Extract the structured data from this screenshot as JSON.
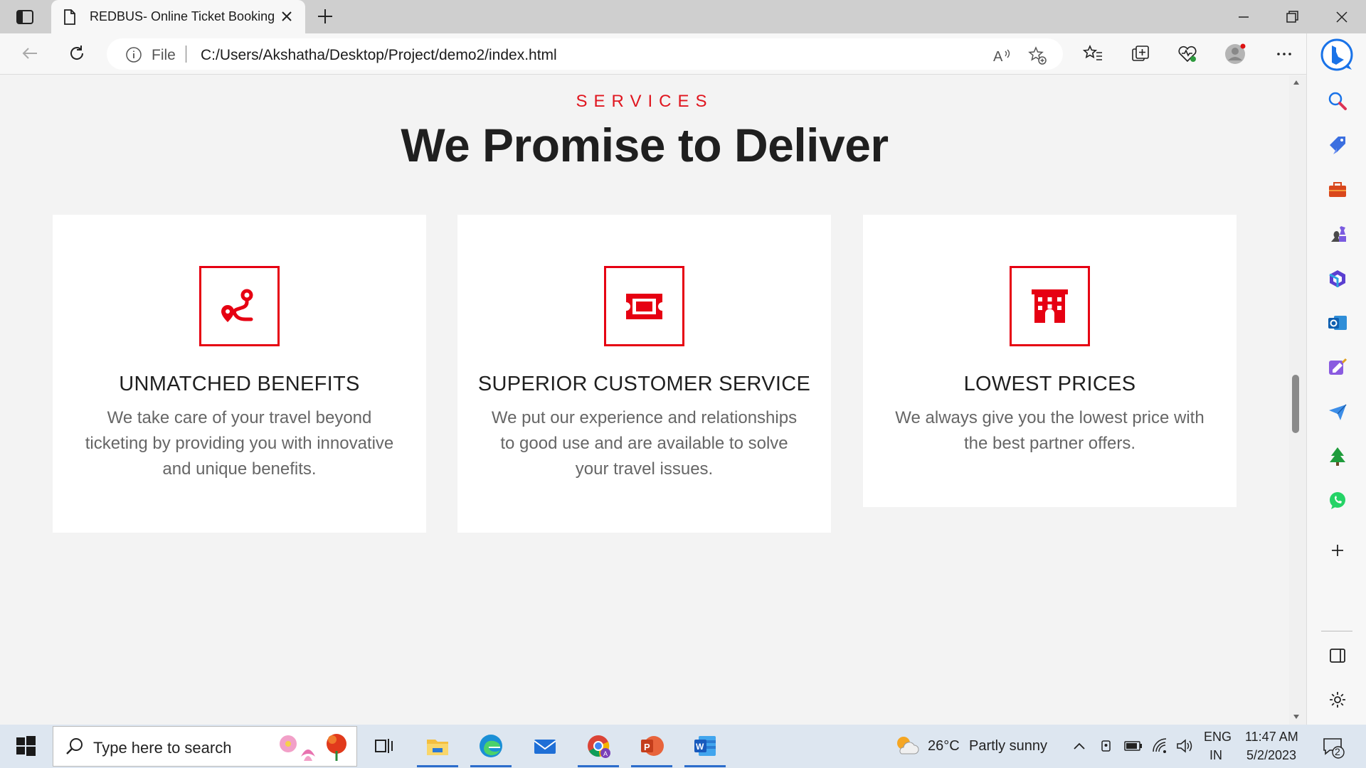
{
  "browser": {
    "tab_title": "REDBUS- Online Ticket Booking",
    "url_prefix": "File",
    "url": "C:/Users/Akshatha/Desktop/Project/demo2/index.html"
  },
  "page": {
    "kicker": "SERVICES",
    "heading": "We Promise to Deliver",
    "cards": [
      {
        "title": "UNMATCHED BENEFITS",
        "description": "We take care of your travel beyond ticketing by providing you with innovative and unique benefits.",
        "icon": "route-icon"
      },
      {
        "title": "SUPERIOR CUSTOMER SERVICE",
        "description": "We put our experience and relationships to good use and are available to solve your travel issues.",
        "icon": "ticket-icon"
      },
      {
        "title": "LOWEST PRICES",
        "description": "We always give you the lowest price with the best partner offers.",
        "icon": "building-icon"
      }
    ],
    "accent_color": "#e60012"
  },
  "taskbar": {
    "search_placeholder": "Type here to search",
    "weather_temp": "26°C",
    "weather_text": "Partly sunny",
    "language": "ENG",
    "region": "IN",
    "time": "11:47 AM",
    "date": "5/2/2023",
    "notification_count": "2"
  }
}
